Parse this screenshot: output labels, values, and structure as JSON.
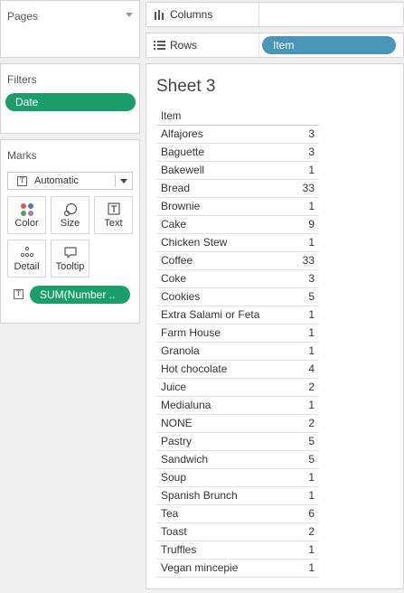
{
  "pages": {
    "title": "Pages"
  },
  "filters": {
    "title": "Filters",
    "pills": [
      "Date"
    ]
  },
  "marks": {
    "title": "Marks",
    "mark_type": "Automatic",
    "buttons": {
      "color": "Color",
      "size": "Size",
      "text": "Text",
      "detail": "Detail",
      "tooltip": "Tooltip"
    },
    "measure_pill": "SUM(Number .."
  },
  "shelves": {
    "columns_label": "Columns",
    "rows_label": "Rows",
    "rows_pill": "Item"
  },
  "sheet": {
    "title": "Sheet 3",
    "column_header": "Item",
    "rows": [
      {
        "item": "Alfajores",
        "value": "3"
      },
      {
        "item": "Baguette",
        "value": "3"
      },
      {
        "item": "Bakewell",
        "value": "1"
      },
      {
        "item": "Bread",
        "value": "33"
      },
      {
        "item": "Brownie",
        "value": "1"
      },
      {
        "item": "Cake",
        "value": "9"
      },
      {
        "item": "Chicken Stew",
        "value": "1"
      },
      {
        "item": "Coffee",
        "value": "33"
      },
      {
        "item": "Coke",
        "value": "3"
      },
      {
        "item": "Cookies",
        "value": "5"
      },
      {
        "item": "Extra Salami or Feta",
        "value": "1"
      },
      {
        "item": "Farm House",
        "value": "1"
      },
      {
        "item": "Granola",
        "value": "1"
      },
      {
        "item": "Hot chocolate",
        "value": "4"
      },
      {
        "item": "Juice",
        "value": "2"
      },
      {
        "item": "Medialuna",
        "value": "1"
      },
      {
        "item": "NONE",
        "value": "2"
      },
      {
        "item": "Pastry",
        "value": "5"
      },
      {
        "item": "Sandwich",
        "value": "5"
      },
      {
        "item": "Soup",
        "value": "1"
      },
      {
        "item": "Spanish Brunch",
        "value": "1"
      },
      {
        "item": "Tea",
        "value": "6"
      },
      {
        "item": "Toast",
        "value": "2"
      },
      {
        "item": "Truffles",
        "value": "1"
      },
      {
        "item": "Vegan mincepie",
        "value": "1"
      }
    ]
  },
  "colors": {
    "filter_pill": "#1b9e6b",
    "dimension_pill": "#4a96b8"
  }
}
